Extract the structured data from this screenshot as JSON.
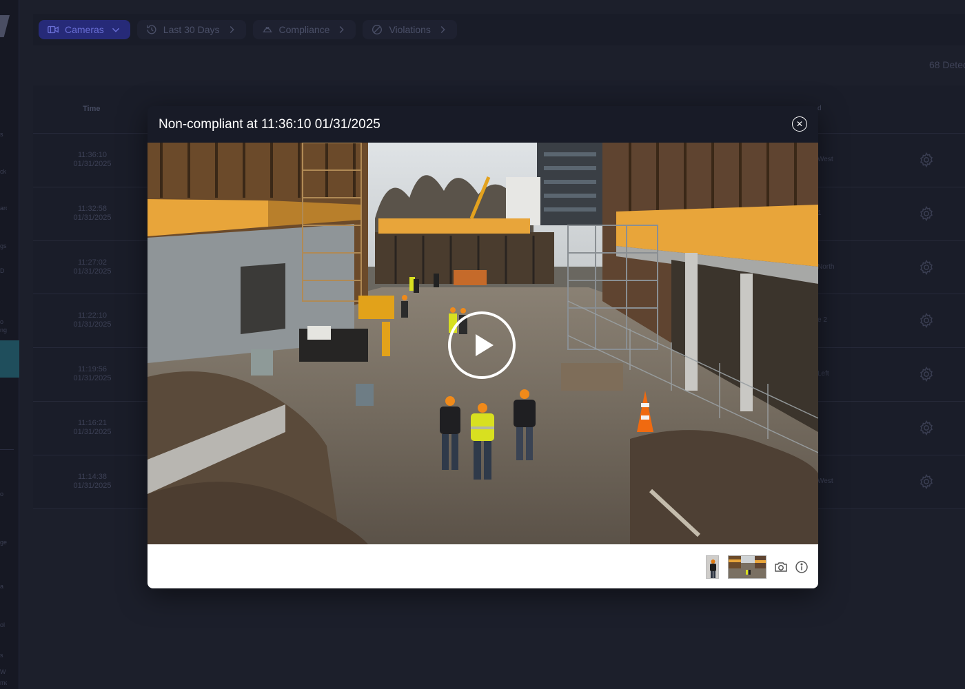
{
  "topbar": {
    "crumbs": [
      {
        "label": "Cameras",
        "icon": "camera-icon"
      },
      {
        "label": "Last 30 Days",
        "icon": "history-icon"
      },
      {
        "label": "Compliance",
        "icon": "hardhat-icon"
      },
      {
        "label": "Violations",
        "icon": "prohibited-icon"
      }
    ]
  },
  "detections_label": "68 Detec",
  "table": {
    "header_time": "Time",
    "header_right": "d",
    "rows": [
      {
        "time": "11:36:10",
        "date": "01/31/2025",
        "right": "West"
      },
      {
        "time": "11:32:58",
        "date": "01/31/2025",
        "right": "1"
      },
      {
        "time": "11:27:02",
        "date": "01/31/2025",
        "right": "North"
      },
      {
        "time": "11:22:10",
        "date": "01/31/2025",
        "right": "e 2"
      },
      {
        "time": "11:19:56",
        "date": "01/31/2025",
        "right": "Left"
      },
      {
        "time": "11:16:21",
        "date": "01/31/2025",
        "right": ""
      },
      {
        "time": "11:14:38",
        "date": "01/31/2025",
        "right": "West"
      }
    ]
  },
  "sidebar": {
    "fragments": [
      "s",
      "ck",
      "ard",
      "gs",
      "D",
      "o",
      "ng",
      "o",
      "ge",
      "a",
      "ol",
      "s",
      "W",
      "ment"
    ]
  },
  "modal": {
    "title": "Non-compliant at 11:36:10 01/31/2025",
    "close_icon": "close-icon",
    "play_icon": "play-icon",
    "footer": {
      "icons": [
        "camera-snapshot-icon",
        "info-icon"
      ]
    }
  },
  "colors": {
    "background": "#1c1f2b",
    "primary_crumb": "#262a78",
    "hi_vis_vest": "#d8e020",
    "hardhat": "#f08a1a",
    "safety_netting": "#e8a53a"
  }
}
